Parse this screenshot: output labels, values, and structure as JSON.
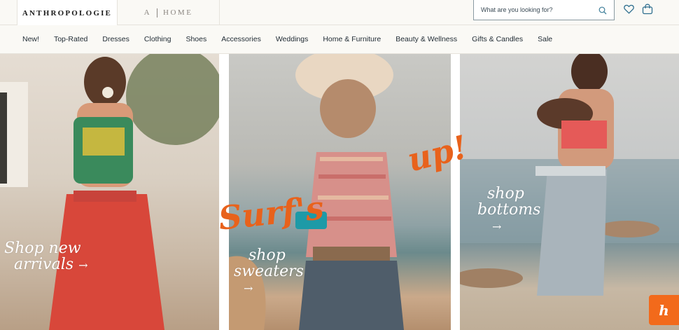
{
  "header": {
    "brand_anthropologie": "ANTHROPOLOGIE",
    "brand_home_a": "A",
    "brand_home_text": "HOME",
    "search_placeholder": "What are you looking for?",
    "icons": [
      "search-icon",
      "heart-icon",
      "bag-icon"
    ]
  },
  "nav": {
    "items": [
      "New!",
      "Top-Rated",
      "Dresses",
      "Clothing",
      "Shoes",
      "Accessories",
      "Weddings",
      "Home & Furniture",
      "Beauty & Wellness",
      "Gifts & Candles",
      "Sale"
    ]
  },
  "hero": {
    "headline_part1": "Surf's",
    "headline_part2": "up!",
    "panels": [
      {
        "cta_line1": "Shop new",
        "cta_line2": "arrivals",
        "arrow": "→"
      },
      {
        "cta_line1": "shop",
        "cta_line2": "sweaters",
        "arrow": "→"
      },
      {
        "cta_line1": "shop",
        "cta_line2": "bottoms",
        "arrow": "→"
      }
    ]
  },
  "widget": {
    "honey_glyph": "h"
  },
  "colors": {
    "accent_orange": "#e8621c",
    "honey_orange": "#f26a1b",
    "nav_bg": "#faf9f5"
  }
}
